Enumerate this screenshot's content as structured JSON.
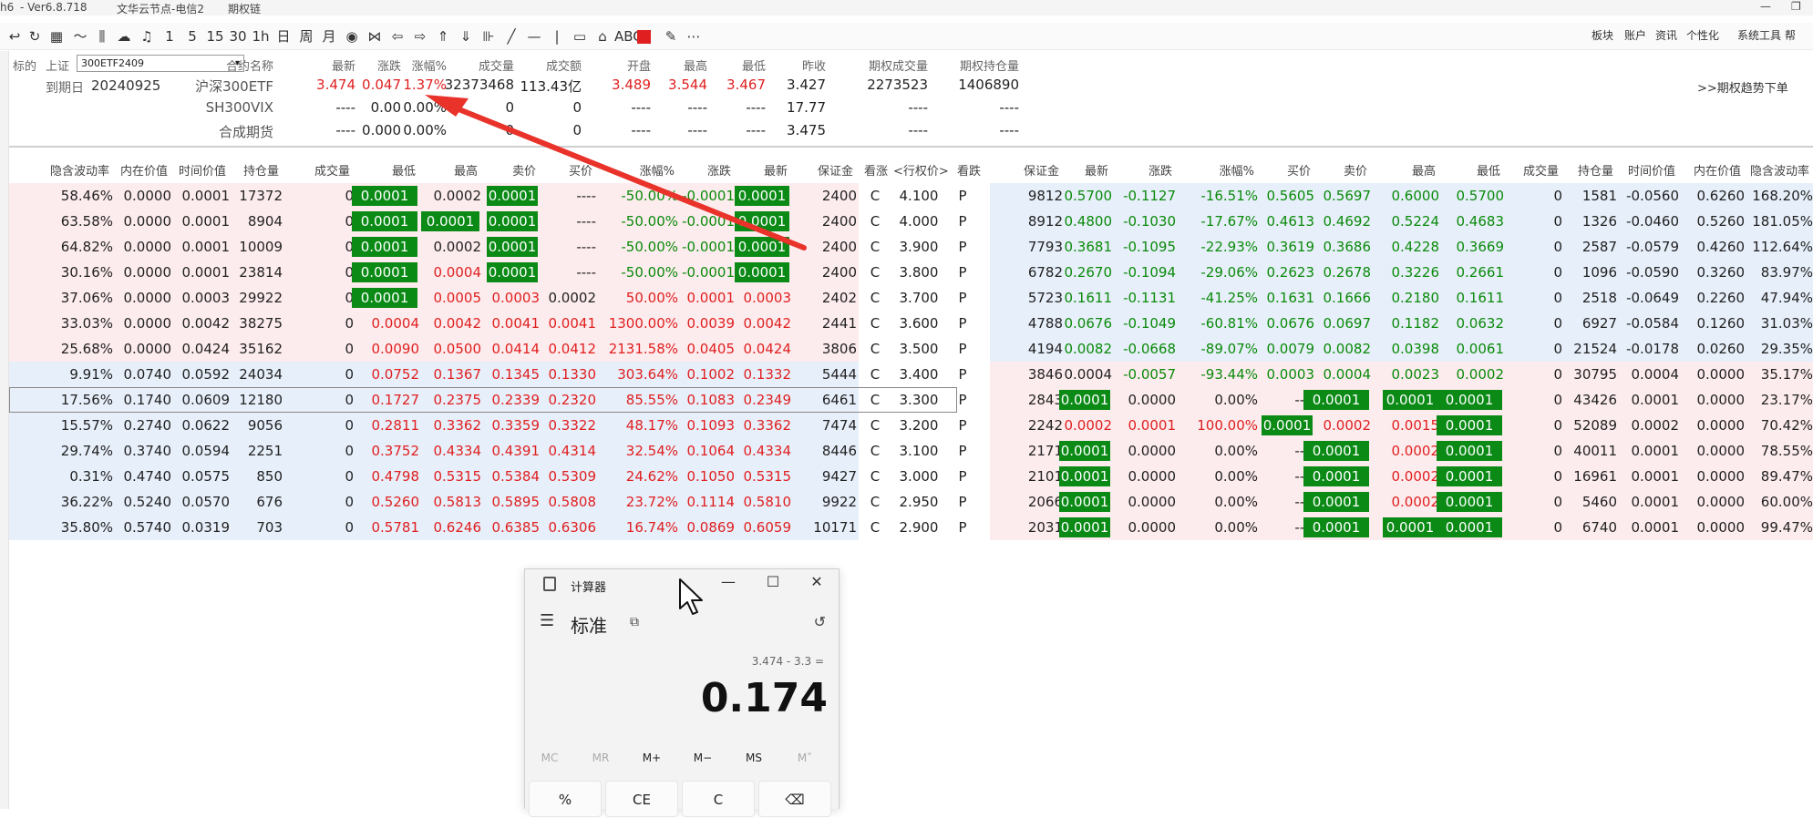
{
  "titlebar": {
    "title_left": "h6",
    "version": "- Ver6.8.718",
    "server": "文华云节点-电信2",
    "module": "期权链",
    "minimize": "—",
    "restore": "❐"
  },
  "toolbar": {
    "icons": [
      "back-icon",
      "refresh-icon",
      "grid-icon",
      "line-chart-icon",
      "kline-icon",
      "cloud-icon",
      "bell-icon",
      "1",
      "5",
      "15",
      "30",
      "1h",
      "日",
      "周",
      "月",
      "eye-icon",
      "bowtie-icon",
      "left-arrow-icon",
      "right-arrow-icon",
      "up-double-icon",
      "down-double-icon",
      "split-icon",
      "pen-icon",
      "hline-icon",
      "vline-icon",
      "rect-icon",
      "home-icon",
      "ABC",
      "red-square-icon",
      "eraser-icon",
      "more-icon"
    ],
    "glyphs": [
      "↩",
      "↻",
      "▦",
      "〜",
      "⫼",
      "☁",
      "♫",
      "1",
      "5",
      "15",
      "30",
      "1h",
      "日",
      "周",
      "月",
      "◉",
      "⋈",
      "⇦",
      "⇨",
      "⇑",
      "⇓",
      "⊪",
      "╱",
      "—",
      "|",
      "▭",
      "⌂",
      "ABC",
      "",
      "✎",
      "⋯"
    ],
    "right_menu": [
      "板块",
      "账户",
      "资讯",
      "个性化",
      "系统工具",
      "帮"
    ],
    "accent": "#e02020"
  },
  "header": {
    "underlying_label": "标的",
    "exchange": "上证",
    "selected_contract": "300ETF2409",
    "expiry_label": "到期日",
    "expiry_date": "20240925",
    "link_text": ">>期权趋势下单",
    "columns": [
      "合约名称",
      "最新",
      "涨跌",
      "涨幅%",
      "成交量",
      "成交额",
      "开盘",
      "最高",
      "最低",
      "昨收",
      "期权成交量",
      "期权持仓量"
    ],
    "quotes": [
      {
        "name": "沪深300ETF",
        "last": "3.474",
        "change": "0.047",
        "pct": "1.37%",
        "volume": "32373468",
        "amount": "113.43亿",
        "open": "3.489",
        "high": "3.544",
        "low": "3.467",
        "prev": "3.427",
        "opt_vol": "2273523",
        "opt_oi": "1406890"
      },
      {
        "name": "SH300VIX",
        "last": "----",
        "change": "0.00",
        "pct": "0.00%",
        "volume": "0",
        "amount": "0",
        "open": "----",
        "high": "----",
        "low": "----",
        "prev": "17.77",
        "opt_vol": "----",
        "opt_oi": "----"
      },
      {
        "name": "合成期货",
        "last": "----",
        "change": "0.000",
        "pct": "0.00%",
        "volume": "0",
        "amount": "0",
        "open": "----",
        "high": "----",
        "low": "----",
        "prev": "3.475",
        "opt_vol": "----",
        "opt_oi": "----"
      }
    ]
  },
  "chain": {
    "left_headers": [
      "隐含波动率",
      "内在价值",
      "时间价值",
      "持仓量",
      "成交量",
      "最低",
      "最高",
      "卖价",
      "买价",
      "涨幅%",
      "涨跌",
      "最新",
      "保证金"
    ],
    "mid_headers": [
      "看涨",
      "<行权价>",
      "看跌"
    ],
    "right_headers": [
      "保证金",
      "最新",
      "涨跌",
      "涨幅%",
      "买价",
      "卖价",
      "最高",
      "最低",
      "成交量",
      "持仓量",
      "时间价值",
      "内在价值",
      "隐含波动率"
    ],
    "rows": [
      {
        "call": [
          "58.46%",
          "0.0000",
          "0.0001",
          "17372",
          "0",
          "0.0001",
          "0.0002",
          "0.0001",
          "----",
          "-50.00%",
          "-0.0001",
          "0.0001",
          "2400"
        ],
        "c": "C",
        "strike": "4.100",
        "p": "P",
        "put": [
          "9812",
          "0.5700",
          "-0.1127",
          "-16.51%",
          "0.5605",
          "0.5697",
          "0.6000",
          "0.5700",
          "0",
          "1581",
          "-0.0560",
          "0.6260",
          "168.20%"
        ]
      },
      {
        "call": [
          "63.58%",
          "0.0000",
          "0.0001",
          "8904",
          "0",
          "0.0001",
          "0.0001",
          "0.0001",
          "----",
          "-50.00%",
          "-0.0001",
          "0.0001",
          "2400"
        ],
        "c": "C",
        "strike": "4.000",
        "p": "P",
        "put": [
          "8912",
          "0.4800",
          "-0.1030",
          "-17.67%",
          "0.4613",
          "0.4692",
          "0.5224",
          "0.4683",
          "0",
          "1326",
          "-0.0460",
          "0.5260",
          "181.05%"
        ]
      },
      {
        "call": [
          "64.82%",
          "0.0000",
          "0.0001",
          "10009",
          "0",
          "0.0001",
          "0.0002",
          "0.0001",
          "----",
          "-50.00%",
          "-0.0001",
          "0.0001",
          "2400"
        ],
        "c": "C",
        "strike": "3.900",
        "p": "P",
        "put": [
          "7793",
          "0.3681",
          "-0.1095",
          "-22.93%",
          "0.3619",
          "0.3686",
          "0.4228",
          "0.3669",
          "0",
          "2587",
          "-0.0579",
          "0.4260",
          "112.64%"
        ]
      },
      {
        "call": [
          "30.16%",
          "0.0000",
          "0.0001",
          "23814",
          "0",
          "0.0001",
          "0.0004",
          "0.0001",
          "----",
          "-50.00%",
          "-0.0001",
          "0.0001",
          "2400"
        ],
        "c": "C",
        "strike": "3.800",
        "p": "P",
        "put": [
          "6782",
          "0.2670",
          "-0.1094",
          "-29.06%",
          "0.2623",
          "0.2678",
          "0.3226",
          "0.2661",
          "0",
          "1096",
          "-0.0590",
          "0.3260",
          "83.97%"
        ]
      },
      {
        "call": [
          "37.06%",
          "0.0000",
          "0.0003",
          "29922",
          "0",
          "0.0001",
          "0.0005",
          "0.0003",
          "0.0002",
          "50.00%",
          "0.0001",
          "0.0003",
          "2402"
        ],
        "c": "C",
        "strike": "3.700",
        "p": "P",
        "put": [
          "5723",
          "0.1611",
          "-0.1131",
          "-41.25%",
          "0.1631",
          "0.1666",
          "0.2180",
          "0.1611",
          "0",
          "2518",
          "-0.0649",
          "0.2260",
          "47.94%"
        ]
      },
      {
        "call": [
          "33.03%",
          "0.0000",
          "0.0042",
          "38275",
          "0",
          "0.0004",
          "0.0042",
          "0.0041",
          "0.0041",
          "1300.00%",
          "0.0039",
          "0.0042",
          "2441"
        ],
        "c": "C",
        "strike": "3.600",
        "p": "P",
        "put": [
          "4788",
          "0.0676",
          "-0.1049",
          "-60.81%",
          "0.0676",
          "0.0697",
          "0.1182",
          "0.0632",
          "0",
          "6927",
          "-0.0584",
          "0.1260",
          "31.03%"
        ]
      },
      {
        "call": [
          "25.68%",
          "0.0000",
          "0.0424",
          "35162",
          "0",
          "0.0090",
          "0.0500",
          "0.0414",
          "0.0412",
          "2131.58%",
          "0.0405",
          "0.0424",
          "3806"
        ],
        "c": "C",
        "strike": "3.500",
        "p": "P",
        "put": [
          "4194",
          "0.0082",
          "-0.0668",
          "-89.07%",
          "0.0079",
          "0.0082",
          "0.0398",
          "0.0061",
          "0",
          "21524",
          "-0.0178",
          "0.0260",
          "29.35%"
        ]
      },
      {
        "call": [
          "9.91%",
          "0.0740",
          "0.0592",
          "24034",
          "0",
          "0.0752",
          "0.1367",
          "0.1345",
          "0.1330",
          "303.64%",
          "0.1002",
          "0.1332",
          "5444"
        ],
        "c": "C",
        "strike": "3.400",
        "p": "P",
        "put": [
          "3846",
          "0.0004",
          "-0.0057",
          "-93.44%",
          "0.0003",
          "0.0004",
          "0.0023",
          "0.0002",
          "0",
          "30795",
          "0.0004",
          "0.0000",
          "35.17%"
        ]
      },
      {
        "call": [
          "17.56%",
          "0.1740",
          "0.0609",
          "12180",
          "0",
          "0.1727",
          "0.2375",
          "0.2339",
          "0.2320",
          "85.55%",
          "0.1083",
          "0.2349",
          "6461"
        ],
        "c": "C",
        "strike": "3.300",
        "p": "P",
        "put": [
          "2843",
          "0.0001",
          "0.0000",
          "0.00%",
          "----",
          "0.0001",
          "0.0001",
          "0.0001",
          "0",
          "43426",
          "0.0001",
          "0.0000",
          "23.17%"
        ]
      },
      {
        "call": [
          "15.57%",
          "0.2740",
          "0.0622",
          "9056",
          "0",
          "0.2811",
          "0.3362",
          "0.3359",
          "0.3322",
          "48.17%",
          "0.1093",
          "0.3362",
          "7474"
        ],
        "c": "C",
        "strike": "3.200",
        "p": "P",
        "put": [
          "2242",
          "0.0002",
          "0.0001",
          "100.00%",
          "0.0001",
          "0.0002",
          "0.0015",
          "0.0001",
          "0",
          "52089",
          "0.0002",
          "0.0000",
          "70.42%"
        ]
      },
      {
        "call": [
          "29.74%",
          "0.3740",
          "0.0594",
          "2251",
          "0",
          "0.3752",
          "0.4334",
          "0.4391",
          "0.4314",
          "32.54%",
          "0.1064",
          "0.4334",
          "8446"
        ],
        "c": "C",
        "strike": "3.100",
        "p": "P",
        "put": [
          "2171",
          "0.0001",
          "0.0000",
          "0.00%",
          "----",
          "0.0001",
          "0.0002",
          "0.0001",
          "0",
          "40011",
          "0.0001",
          "0.0000",
          "78.55%"
        ]
      },
      {
        "call": [
          "0.31%",
          "0.4740",
          "0.0575",
          "850",
          "0",
          "0.4798",
          "0.5315",
          "0.5384",
          "0.5309",
          "24.62%",
          "0.1050",
          "0.5315",
          "9427"
        ],
        "c": "C",
        "strike": "3.000",
        "p": "P",
        "put": [
          "2101",
          "0.0001",
          "0.0000",
          "0.00%",
          "----",
          "0.0001",
          "0.0002",
          "0.0001",
          "0",
          "16961",
          "0.0001",
          "0.0000",
          "89.47%"
        ]
      },
      {
        "call": [
          "36.22%",
          "0.5240",
          "0.0570",
          "676",
          "0",
          "0.5260",
          "0.5813",
          "0.5895",
          "0.5808",
          "23.72%",
          "0.1114",
          "0.5810",
          "9922"
        ],
        "c": "C",
        "strike": "2.950",
        "p": "P",
        "put": [
          "2066",
          "0.0001",
          "0.0000",
          "0.00%",
          "----",
          "0.0001",
          "0.0002",
          "0.0001",
          "0",
          "5460",
          "0.0001",
          "0.0000",
          "60.00%"
        ]
      },
      {
        "call": [
          "35.80%",
          "0.5740",
          "0.0319",
          "703",
          "0",
          "0.5781",
          "0.6246",
          "0.6385",
          "0.6306",
          "16.74%",
          "0.0869",
          "0.6059",
          "10171"
        ],
        "c": "C",
        "strike": "2.900",
        "p": "P",
        "put": [
          "2031",
          "0.0001",
          "0.0000",
          "0.00%",
          "----",
          "0.0001",
          "0.0001",
          "0.0001",
          "0",
          "6740",
          "0.0001",
          "0.0000",
          "99.47%"
        ]
      }
    ]
  },
  "calculator": {
    "title": "计算器",
    "mode": "标准",
    "expression": "3.474 - 3.3 =",
    "result": "0.174",
    "memory": [
      "MC",
      "MR",
      "M+",
      "M−",
      "MS",
      "M˅"
    ],
    "buttons": [
      "%",
      "CE",
      "C",
      "⌫"
    ],
    "min": "—",
    "max": "☐",
    "close": "✕",
    "menu_glyph": "☰",
    "pin_glyph": "⧉",
    "history_glyph": "↺"
  }
}
